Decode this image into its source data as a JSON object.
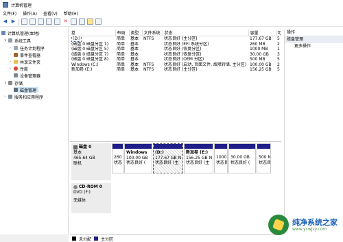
{
  "window": {
    "title": "计算机管理"
  },
  "menu": [
    "文件(F)",
    "操作(A)",
    "查看(V)",
    "帮助(H)"
  ],
  "tree": {
    "root": "计算机管理(本地)",
    "system_tools": "系统工具",
    "task_scheduler": "任务计划程序",
    "event_viewer": "事件查看器",
    "shared_folders": "共享文件夹",
    "performance": "性能",
    "device_manager": "设备管理器",
    "storage": "存储",
    "disk_management": "磁盘管理",
    "services": "服务和应用程序"
  },
  "volumes": {
    "columns": [
      "卷",
      "布局",
      "类型",
      "文件系统",
      "状态",
      "容量",
      "可"
    ],
    "rows": [
      [
        "(D:)",
        "简单",
        "基本",
        "NTFS",
        "状态良好 (主分区)",
        "177.67 GB",
        "5"
      ],
      [
        "(磁盘 0 磁盘分区 1)",
        "简单",
        "基本",
        "",
        "状态良好 (EFI 系统分区)",
        "260 MB",
        "2"
      ],
      [
        "(磁盘 0 磁盘分区 5)",
        "简单",
        "基本",
        "",
        "状态良好 (恢复分区)",
        "1000 MB",
        "1"
      ],
      [
        "(磁盘 0 磁盘分区 7)",
        "简单",
        "基本",
        "",
        "状态良好 (恢复分区)",
        "30.00 GB",
        "3"
      ],
      [
        "(磁盘 0 磁盘分区 8)",
        "简单",
        "基本",
        "",
        "状态良好 (OEM 分区)",
        "500 MB",
        "5"
      ],
      [
        "Windows (C:)",
        "简单",
        "基本",
        "NTFS",
        "状态良好 (启动, 页面文件, 故障转储, 主分区)",
        "100.00 GB",
        "2"
      ],
      [
        "新加卷 (E:)",
        "简单",
        "基本",
        "NTFS",
        "状态良好 (主分区)",
        "156.25 GB",
        "5"
      ]
    ]
  },
  "disk0": {
    "name": "磁盘 0",
    "type": "基本",
    "size": "465.64 GB",
    "status": "联机",
    "partitions": [
      {
        "name": "",
        "size": "260",
        "status": "状态"
      },
      {
        "name": "Windows",
        "size": "100.00 GB",
        "status": "状态良好 ("
      },
      {
        "name": "(D:)",
        "size": "177.67 GB N",
        "status": "状态良好 (主"
      },
      {
        "name": "新加卷  (E:)",
        "size": "156.25 GB N",
        "status": "状态良好 (主"
      },
      {
        "name": "",
        "size": "1000 I",
        "status": "状态良"
      },
      {
        "name": "",
        "size": "30.00 GB",
        "status": "状态良好 ("
      },
      {
        "name": "",
        "size": "500 M",
        "status": "状态良"
      }
    ]
  },
  "cdrom0": {
    "name": "CD-ROM 0",
    "drive": "DVD (F:)",
    "media": "无媒体"
  },
  "legend": [
    "未分配",
    "主分区"
  ],
  "actions": {
    "header": "操作",
    "section": "磁盘管理",
    "more": "更多操作"
  },
  "watermark": {
    "brand": "纯净系统之家",
    "url": "www.ycwjzy.com"
  }
}
